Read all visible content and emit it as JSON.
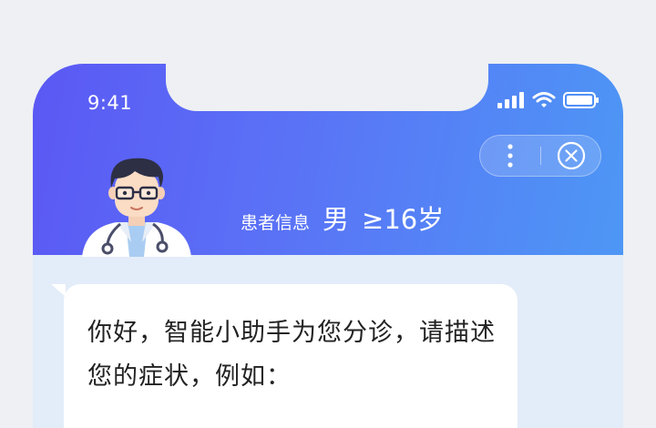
{
  "status_bar": {
    "time": "9:41",
    "icons": [
      "cellular-signal-icon",
      "wifi-icon",
      "battery-icon"
    ]
  },
  "capsule": {
    "icons": [
      "more-vertical-icon",
      "close-circle-icon"
    ]
  },
  "header": {
    "avatar": "doctor-avatar",
    "patient_label": "患者信息",
    "gender": "男",
    "age": "≥16岁"
  },
  "chat": {
    "greeting": "你好，智能小助手为您分诊，请描述您的症状，例如："
  },
  "colors": {
    "header_gradient_start": "#5b58f4",
    "header_gradient_end": "#4d97f5",
    "chat_background": "#e3ecf9",
    "bubble_background": "#ffffff",
    "text": "#222222"
  }
}
